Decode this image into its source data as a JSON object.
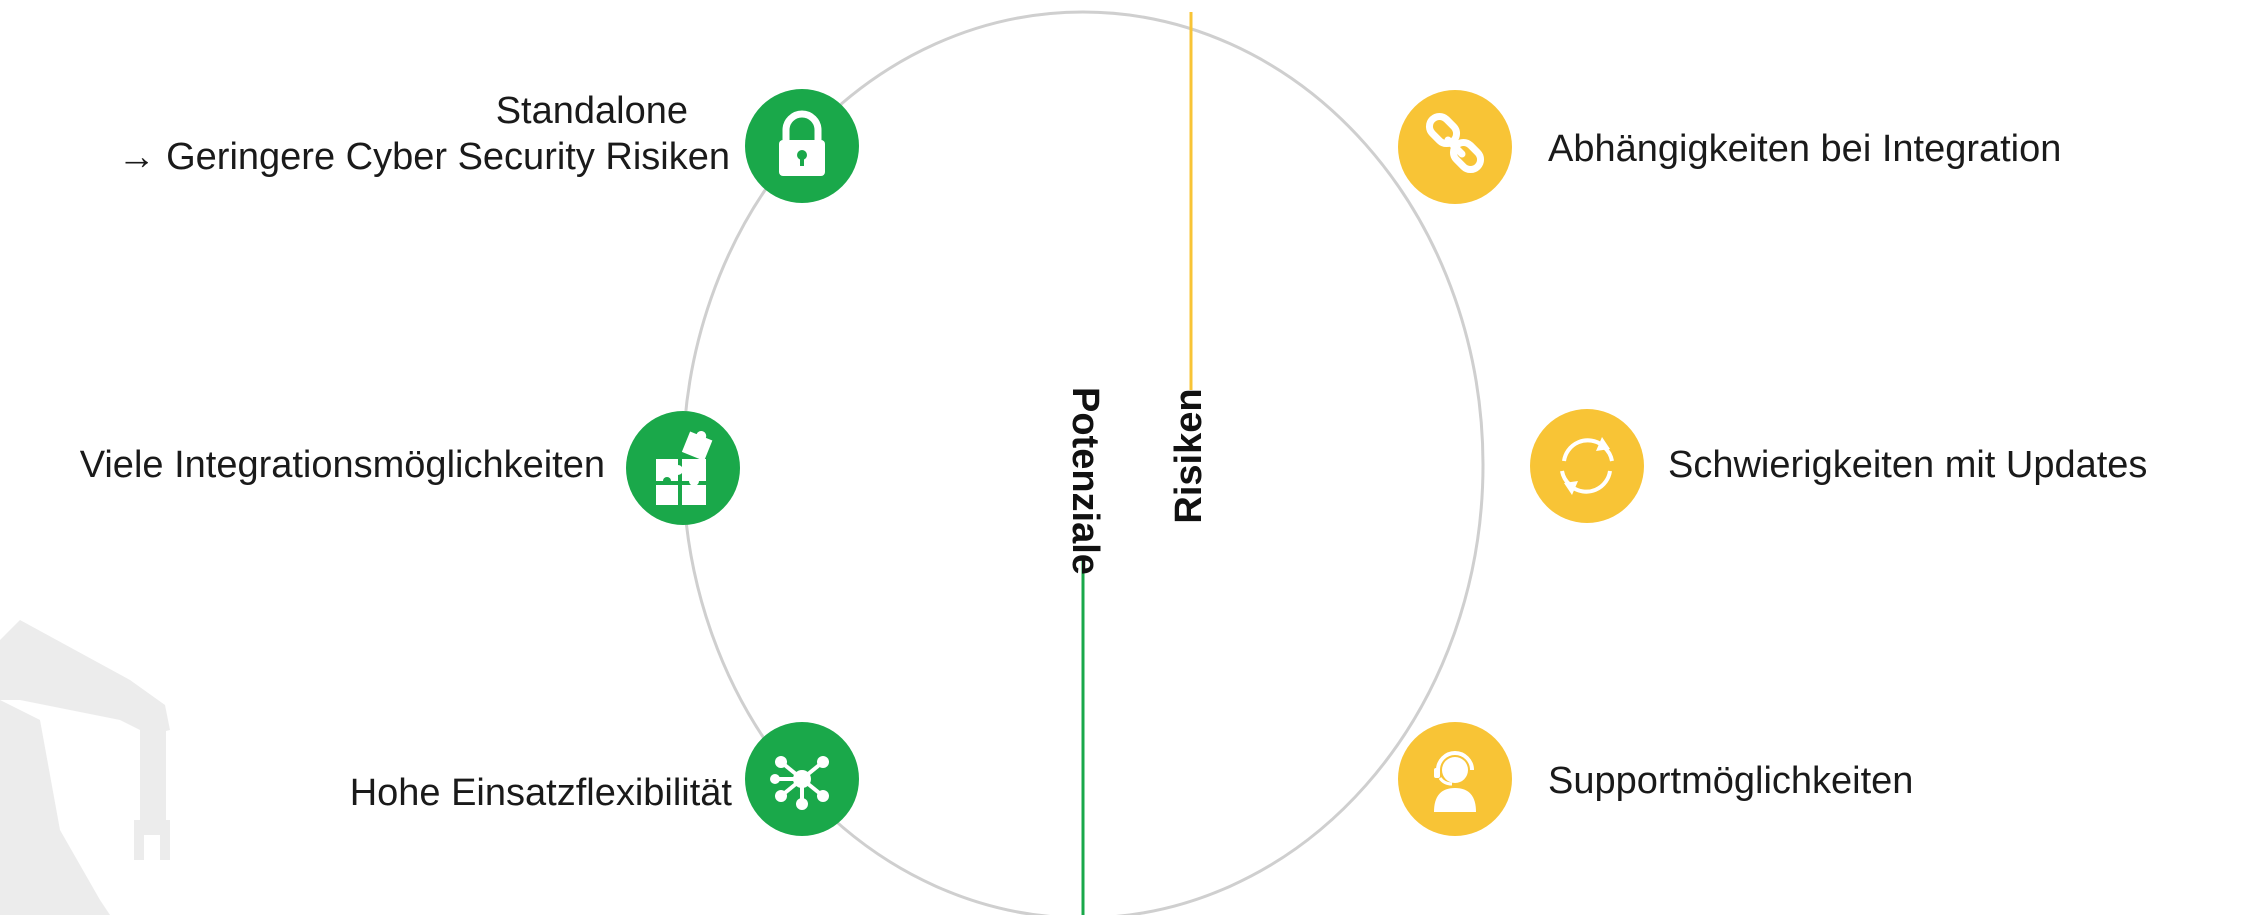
{
  "colors": {
    "potenziale": "#1aa84a",
    "risiken": "#f8c436",
    "circle_outline": "#cfcfcf",
    "watermark": "#ececec"
  },
  "axis": {
    "potenziale_label": "Potenziale",
    "risiken_label": "Risiken"
  },
  "potenziale": [
    {
      "line1": "Standalone",
      "line2": "→ Geringere Cyber Security Risiken",
      "icon": "lock-icon"
    },
    {
      "line1": "Viele Integrationsmöglichkeiten",
      "icon": "puzzle-icon"
    },
    {
      "line1": "Hohe Einsatzflexibilität",
      "icon": "network-hub-icon"
    }
  ],
  "risiken": [
    {
      "line1": "Abhängigkeiten bei Integration",
      "icon": "chain-link-icon"
    },
    {
      "line1": "Schwierigkeiten mit Updates",
      "icon": "refresh-icon"
    },
    {
      "line1": "Supportmöglichkeiten",
      "icon": "support-agent-icon"
    }
  ]
}
